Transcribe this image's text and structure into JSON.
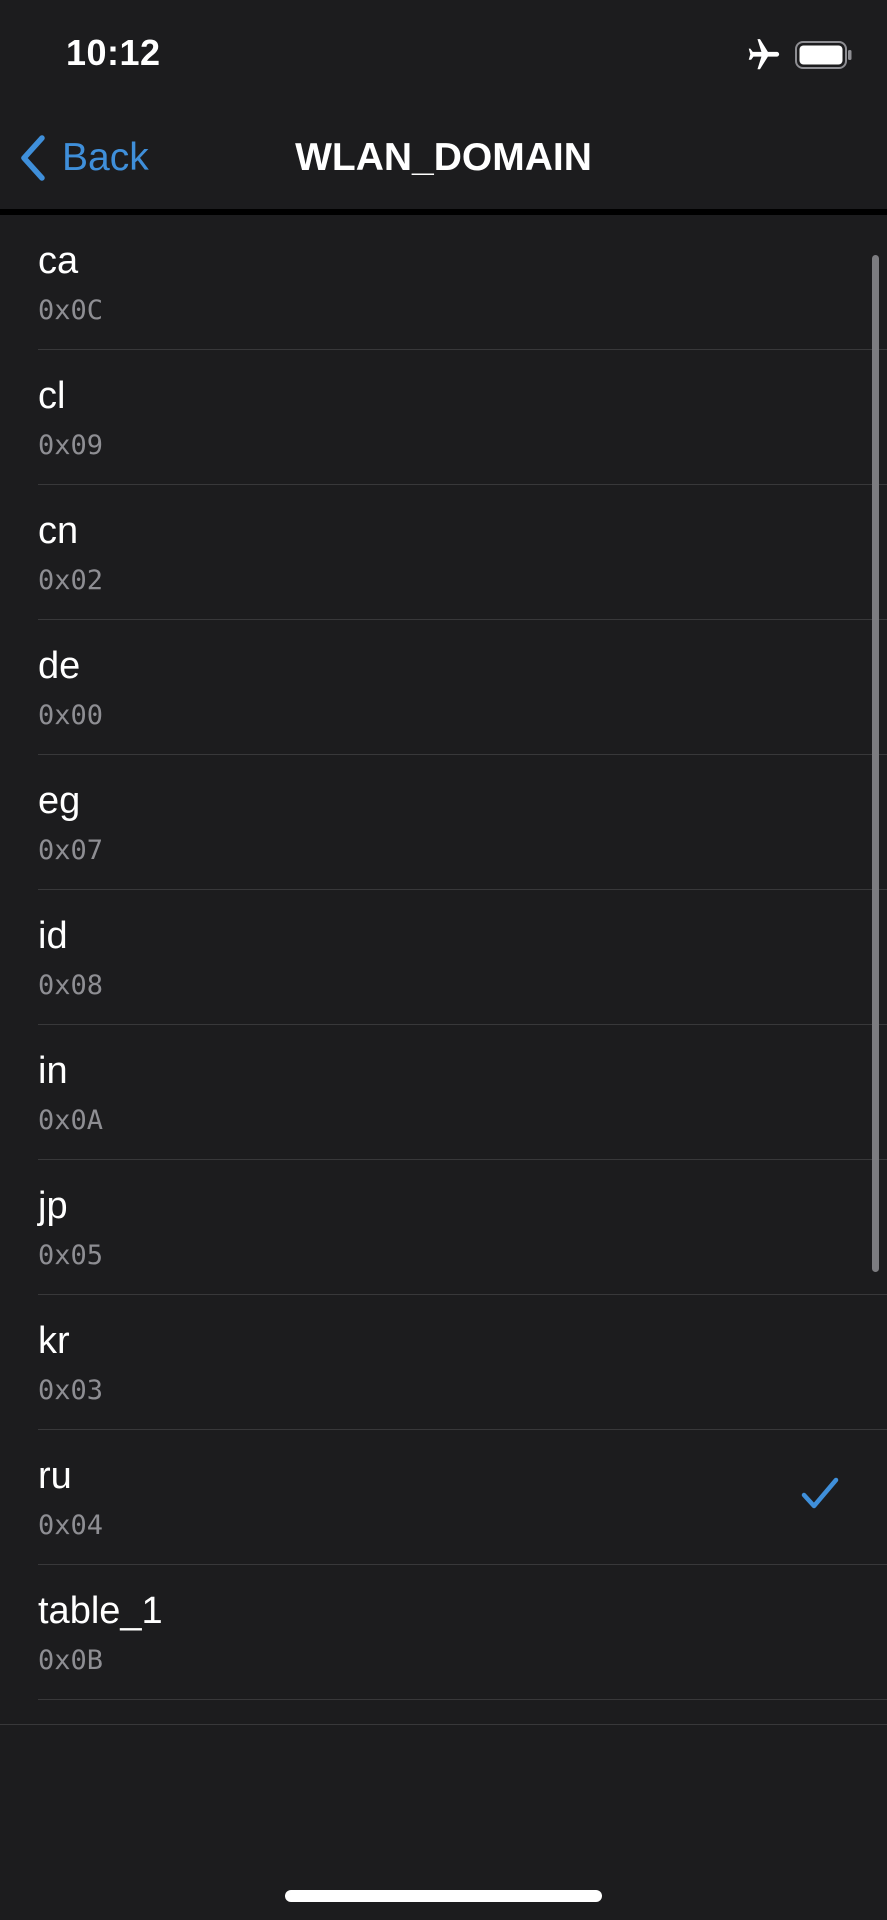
{
  "status_bar": {
    "time": "10:12",
    "icons": [
      "airplane-icon",
      "battery-icon"
    ]
  },
  "nav": {
    "back_label": "Back",
    "title": "WLAN_DOMAIN"
  },
  "colors": {
    "background": "#1c1c1e",
    "accent": "#3f8fda",
    "secondary_text": "#8e8e93",
    "separator": "#38383a"
  },
  "rows": [
    {
      "title": "ca",
      "subtitle": "0x0C",
      "selected": false
    },
    {
      "title": "cl",
      "subtitle": "0x09",
      "selected": false
    },
    {
      "title": "cn",
      "subtitle": "0x02",
      "selected": false
    },
    {
      "title": "de",
      "subtitle": "0x00",
      "selected": false
    },
    {
      "title": "eg",
      "subtitle": "0x07",
      "selected": false
    },
    {
      "title": "id",
      "subtitle": "0x08",
      "selected": false
    },
    {
      "title": "in",
      "subtitle": "0x0A",
      "selected": false
    },
    {
      "title": "jp",
      "subtitle": "0x05",
      "selected": false
    },
    {
      "title": "kr",
      "subtitle": "0x03",
      "selected": false
    },
    {
      "title": "ru",
      "subtitle": "0x04",
      "selected": true
    },
    {
      "title": "table_1",
      "subtitle": "0x0B",
      "selected": false
    }
  ]
}
